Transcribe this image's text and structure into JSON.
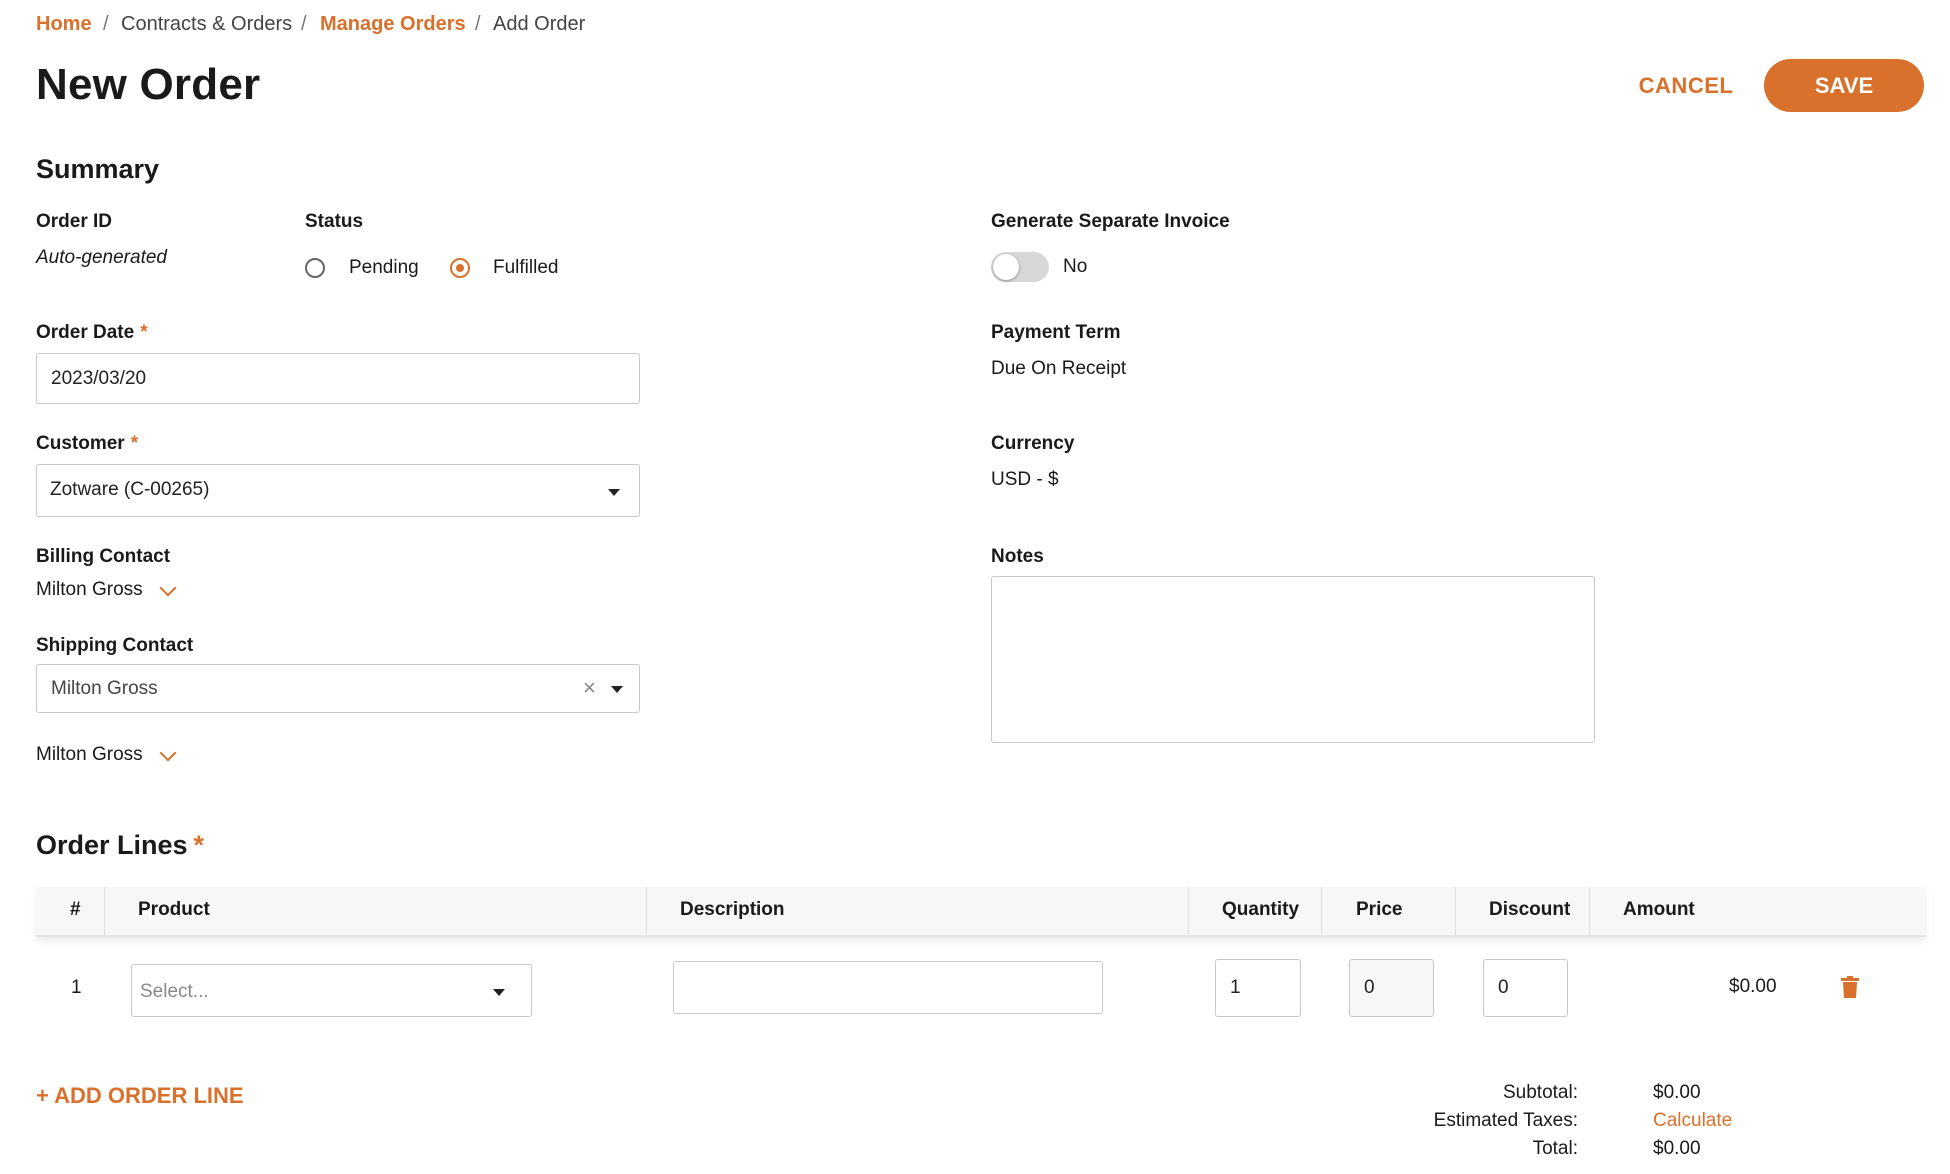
{
  "breadcrumb": {
    "home": "Home",
    "contracts": "Contracts & Orders",
    "manage": "Manage Orders",
    "current": "Add Order",
    "separator": "/"
  },
  "page": {
    "title": "New Order"
  },
  "actions": {
    "cancel": "CANCEL",
    "save": "SAVE"
  },
  "summary": {
    "heading": "Summary",
    "order_id": {
      "label": "Order ID",
      "value": "Auto-generated"
    },
    "status": {
      "label": "Status",
      "options": [
        "Pending",
        "Fulfilled"
      ],
      "selected": "Fulfilled"
    },
    "invoice": {
      "label": "Generate Separate Invoice",
      "value": "No",
      "on": false
    },
    "order_date": {
      "label": "Order Date",
      "value": "2023/03/20"
    },
    "payment_term": {
      "label": "Payment Term",
      "value": "Due On Receipt"
    },
    "customer": {
      "label": "Customer",
      "value": "Zotware (C-00265)"
    },
    "currency": {
      "label": "Currency",
      "value": "USD - $"
    },
    "billing_contact": {
      "label": "Billing Contact",
      "value": "Milton Gross"
    },
    "notes": {
      "label": "Notes",
      "value": ""
    },
    "shipping_contact": {
      "label": "Shipping Contact",
      "value": "Milton Gross",
      "clear": "×",
      "expanded_value": "Milton Gross"
    },
    "required_mark": "*"
  },
  "order_lines": {
    "heading": "Order Lines",
    "columns": [
      "#",
      "Product",
      "Description",
      "Quantity",
      "Price",
      "Discount",
      "Amount"
    ],
    "rows": [
      {
        "num": "1",
        "product_placeholder": "Select...",
        "description": "",
        "quantity": "1",
        "price": "0",
        "discount": "0",
        "amount": "$0.00"
      }
    ],
    "add_line": "+ ADD ORDER LINE"
  },
  "totals": {
    "subtotal_label": "Subtotal:",
    "subtotal": "$0.00",
    "taxes_label": "Estimated Taxes:",
    "taxes": "Calculate",
    "total_label": "Total:",
    "total": "$0.00"
  },
  "colors": {
    "accent": "#d9712c"
  },
  "icons": {
    "delete": "trash-icon",
    "dropdown": "caret-down-icon",
    "expand": "chevron-down-icon"
  }
}
